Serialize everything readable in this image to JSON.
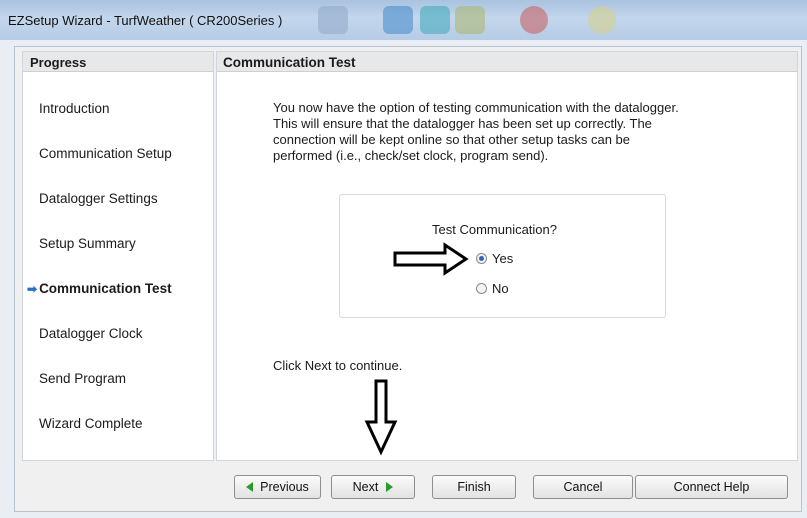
{
  "window": {
    "title": "EZSetup Wizard - TurfWeather ( CR200Series )"
  },
  "sidebar": {
    "header": "Progress",
    "items": [
      {
        "label": "Introduction"
      },
      {
        "label": "Communication Setup"
      },
      {
        "label": "Datalogger Settings"
      },
      {
        "label": "Setup Summary"
      },
      {
        "label": "Communication Test",
        "active": true
      },
      {
        "label": "Datalogger Clock"
      },
      {
        "label": "Send Program"
      },
      {
        "label": "Wizard Complete"
      }
    ]
  },
  "main": {
    "header": "Communication Test",
    "description": "You now have the option of testing communication with the datalogger.\n This will ensure that the datalogger has been set up correctly.  The\nconnection will be kept online so that other setup tasks can be\nperformed (i.e., check/set clock, program send).",
    "test": {
      "question": "Test Communication?",
      "options": [
        {
          "label": "Yes",
          "selected": true
        },
        {
          "label": "No",
          "selected": false
        }
      ]
    },
    "hint": "Click Next to continue."
  },
  "buttons": {
    "previous": "Previous",
    "next": "Next",
    "finish": "Finish",
    "cancel": "Cancel",
    "connect_help": "Connect Help"
  },
  "colors": {
    "accent": "#2f66b3",
    "nav_arrow": "#2a9b2a"
  }
}
